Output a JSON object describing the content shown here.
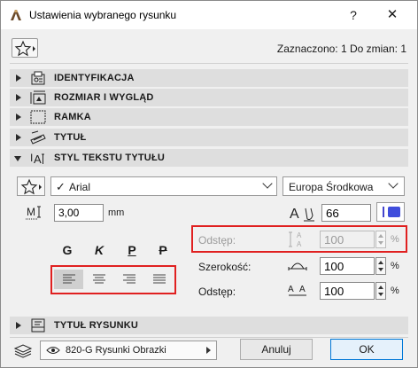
{
  "window": {
    "title": "Ustawienia wybranego rysunku",
    "help_label": "?",
    "close_label": "✕"
  },
  "header": {
    "selection_info": "Zaznaczono: 1 Do zmian: 1"
  },
  "panels": [
    {
      "label": "IDENTYFIKACJA",
      "icon": "id-card-icon",
      "expanded": false
    },
    {
      "label": "ROZMIAR I WYGLĄD",
      "icon": "size-appearance-icon",
      "expanded": false
    },
    {
      "label": "RAMKA",
      "icon": "frame-icon",
      "expanded": false
    },
    {
      "label": "TYTUŁ",
      "icon": "title-icon",
      "expanded": false
    },
    {
      "label": "STYL TEKSTU TYTUŁU",
      "icon": "text-style-icon",
      "expanded": true
    },
    {
      "label": "TYTUŁ RYSUNKU",
      "icon": "drawing-title-icon",
      "expanded": false
    }
  ],
  "text_style": {
    "font": "Arial",
    "encoding": "Europa Środkowa",
    "size": "3,00",
    "size_unit": "mm",
    "pen": "66",
    "pen_color": "#3f4ddc",
    "styles": [
      "G",
      "K",
      "P",
      "P"
    ],
    "alignment_selected": "left"
  },
  "spacing": {
    "row1_label": "Odstęp:",
    "row1_value": "100",
    "row1_unit": "%",
    "width_label": "Szerokość:",
    "width_value": "100",
    "width_unit": "%",
    "row3_label": "Odstęp:",
    "row3_value": "100",
    "row3_unit": "%"
  },
  "footer": {
    "layer": "820-G Rysunki Obrazki",
    "cancel_label": "Anuluj",
    "ok_label": "OK"
  }
}
